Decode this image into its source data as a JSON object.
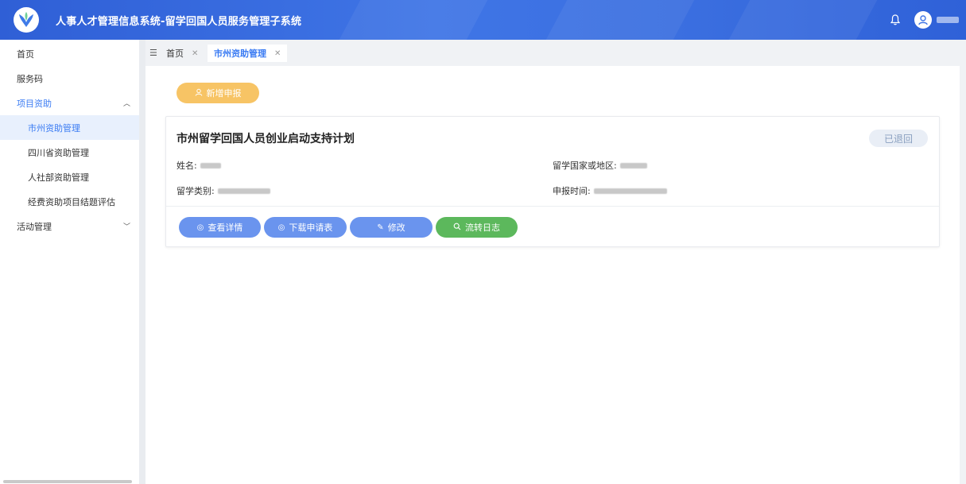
{
  "header": {
    "title": "人事人才管理信息系统-留学回国人员服务管理子系统"
  },
  "sidebar": {
    "items": [
      {
        "label": "首页"
      },
      {
        "label": "服务码"
      },
      {
        "label": "项目资助"
      },
      {
        "label": "市州资助管理"
      },
      {
        "label": "四川省资助管理"
      },
      {
        "label": "人社部资助管理"
      },
      {
        "label": "经费资助项目结题评估"
      },
      {
        "label": "活动管理"
      }
    ]
  },
  "tabs": [
    {
      "label": "首页"
    },
    {
      "label": "市州资助管理"
    }
  ],
  "toolbar": {
    "new_label": "新增申报"
  },
  "card": {
    "title": "市州留学回国人员创业启动支持计划",
    "status": "已退回",
    "fields": {
      "name_label": "姓名:",
      "country_label": "留学国家或地区:",
      "type_label": "留学类别:",
      "time_label": "申报时间:"
    },
    "actions": {
      "view": "查看详情",
      "download": "下载申请表",
      "edit": "修改",
      "log": "流转日志"
    }
  },
  "colors": {
    "header_bg": "#3f75e6",
    "accent": "#3a7bf3",
    "new_button": "#f7c465",
    "action_blue": "#6a94ee",
    "action_green": "#5cb85c"
  }
}
